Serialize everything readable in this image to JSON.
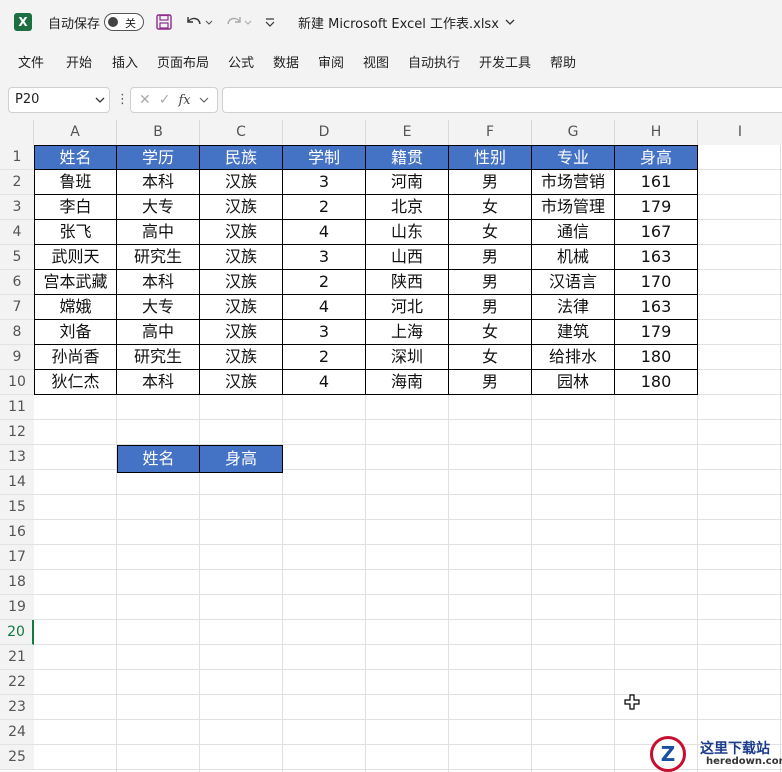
{
  "titlebar": {
    "autosave_label": "自动保存",
    "autosave_state": "关",
    "doc_title": "新建 Microsoft Excel 工作表.xlsx"
  },
  "ribbon": {
    "tabs": [
      "文件",
      "开始",
      "插入",
      "页面布局",
      "公式",
      "数据",
      "审阅",
      "视图",
      "自动执行",
      "开发工具",
      "帮助"
    ]
  },
  "formula_bar": {
    "name_box": "P20",
    "fx_label": "fx",
    "formula": ""
  },
  "sheet": {
    "columns": [
      "A",
      "B",
      "C",
      "D",
      "E",
      "F",
      "G",
      "H",
      "I"
    ],
    "rows": [
      "1",
      "2",
      "3",
      "4",
      "5",
      "6",
      "7",
      "8",
      "9",
      "10",
      "11",
      "12",
      "13",
      "14",
      "15",
      "16",
      "17",
      "18",
      "19",
      "20",
      "21",
      "22",
      "23",
      "24",
      "25"
    ],
    "active_row": "20",
    "table_header": [
      "姓名",
      "学历",
      "民族",
      "学制",
      "籍贯",
      "性别",
      "专业",
      "身高"
    ],
    "table_rows": [
      [
        "鲁班",
        "本科",
        "汉族",
        "3",
        "河南",
        "男",
        "市场营销",
        "161"
      ],
      [
        "李白",
        "大专",
        "汉族",
        "2",
        "北京",
        "女",
        "市场管理",
        "179"
      ],
      [
        "张飞",
        "高中",
        "汉族",
        "4",
        "山东",
        "女",
        "通信",
        "167"
      ],
      [
        "武则天",
        "研究生",
        "汉族",
        "3",
        "山西",
        "男",
        "机械",
        "163"
      ],
      [
        "宫本武藏",
        "本科",
        "汉族",
        "2",
        "陕西",
        "男",
        "汉语言",
        "170"
      ],
      [
        "嫦娥",
        "大专",
        "汉族",
        "4",
        "河北",
        "男",
        "法律",
        "163"
      ],
      [
        "刘备",
        "高中",
        "汉族",
        "3",
        "上海",
        "女",
        "建筑",
        "179"
      ],
      [
        "孙尚香",
        "研究生",
        "汉族",
        "2",
        "深圳",
        "女",
        "给排水",
        "180"
      ],
      [
        "狄仁杰",
        "本科",
        "汉族",
        "4",
        "海南",
        "男",
        "园林",
        "180"
      ]
    ],
    "lookup_header": [
      "姓名",
      "身高"
    ]
  },
  "watermark": {
    "title": "这里下载站",
    "url": "heredown.com"
  },
  "colors": {
    "header_fill": "#4472c4",
    "excel_green": "#107c41"
  }
}
